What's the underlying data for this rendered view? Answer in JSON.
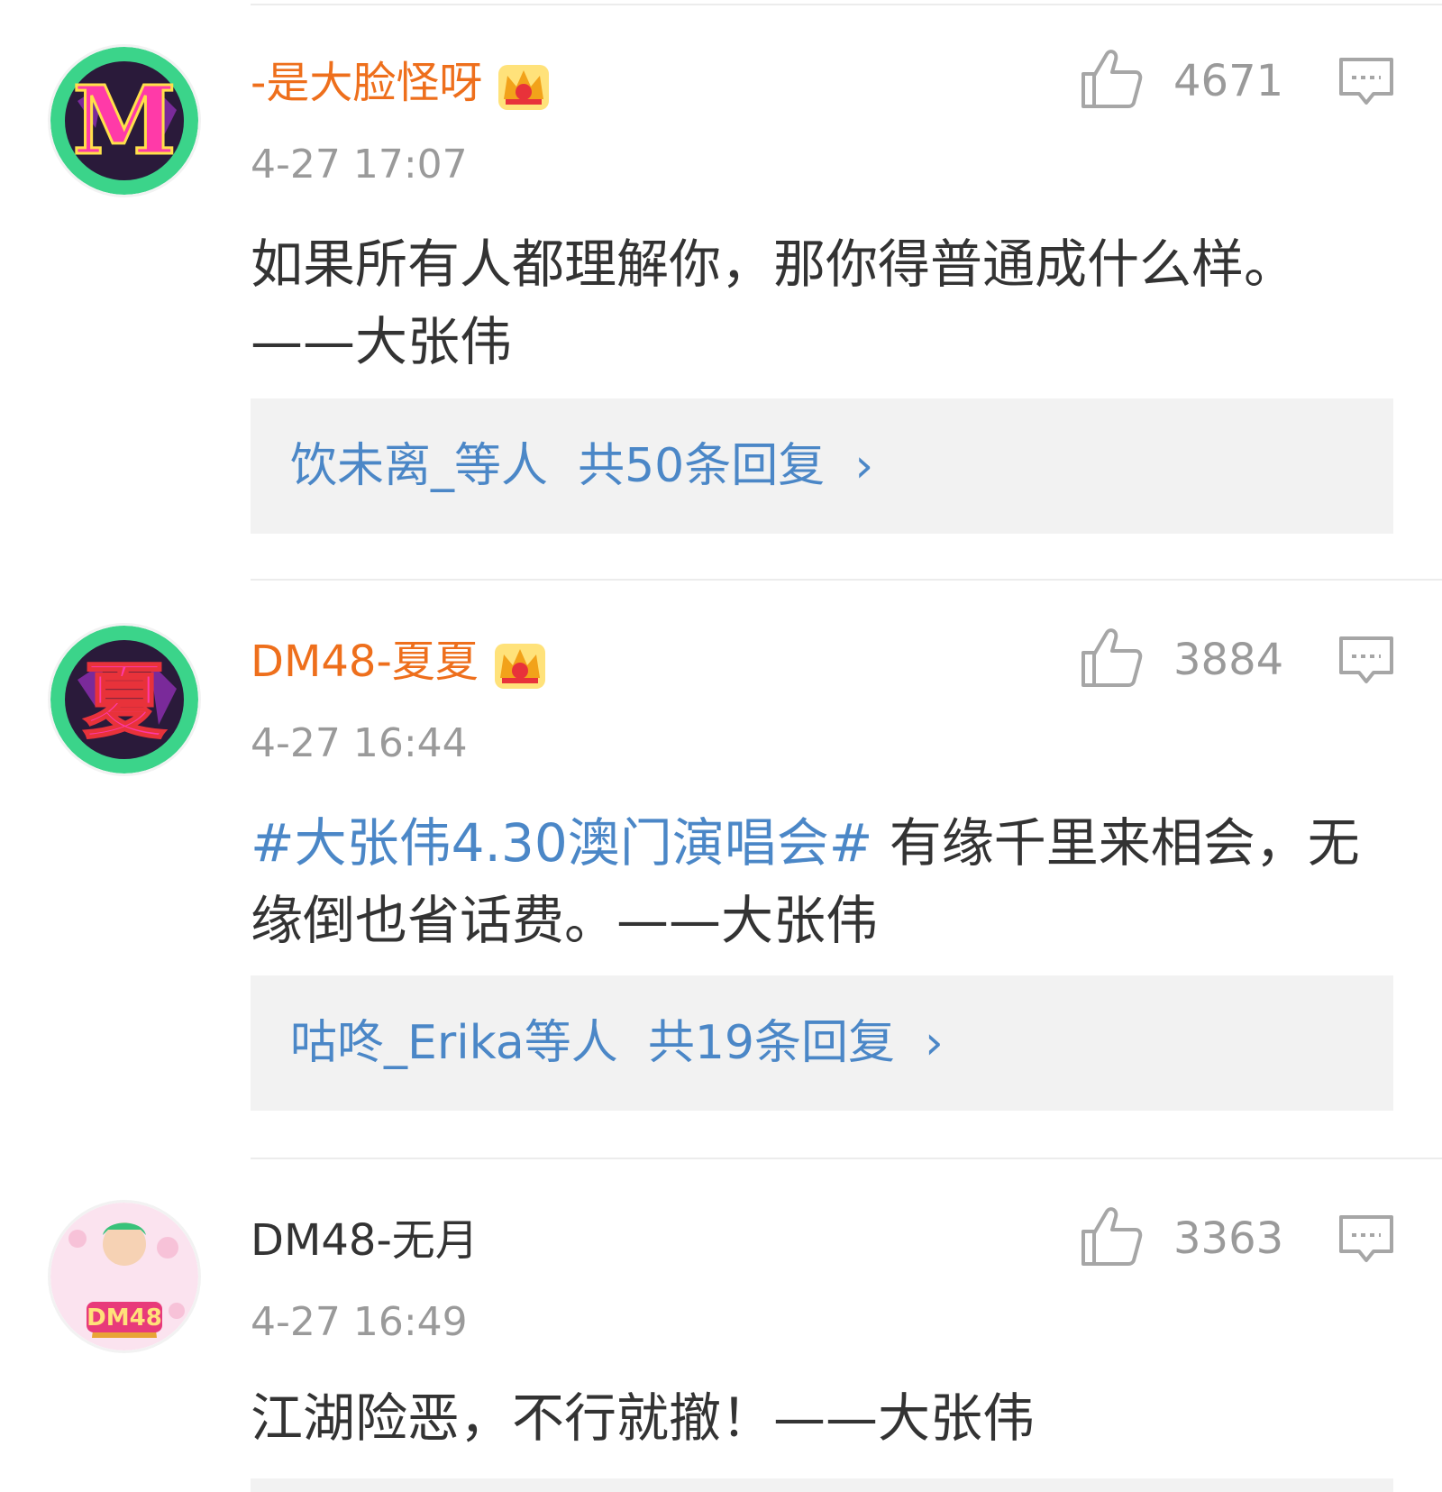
{
  "comments": [
    {
      "username": "-是大脸怪呀",
      "time": "4-27 17:07",
      "topic": "",
      "text": "如果所有人都理解你，那你得普通成什么样。——大张伟",
      "likes": "4671",
      "replies": {
        "users": "饮未离_等人",
        "count": "共50条回复",
        "chevron": "›"
      },
      "avatar_letter": "M"
    },
    {
      "username": "DM48-夏夏",
      "time": "4-27 16:44",
      "topic": "#大张伟4.30澳门演唱会#",
      "text": "有缘千里来相会，无缘倒也省话费。——大张伟",
      "likes": "3884",
      "replies": {
        "users": "咕咚_Erika等人",
        "count": "共19条回复",
        "chevron": "›"
      },
      "avatar_letter": "夏"
    },
    {
      "username": "DM48-无月",
      "time": "4-27 16:49",
      "topic": "",
      "text": "江湖险恶，不行就撤！——大张伟",
      "likes": "3363",
      "avatar_letter": "DM48"
    }
  ],
  "icons": {
    "like": "thumbs-up-icon",
    "comment": "comment-icon",
    "vip": "crown-icon"
  },
  "colors": {
    "vip_name": "#ee6f1c",
    "link": "#4b87c7",
    "meta": "#9a9a9a",
    "reply_bg": "#f2f2f2"
  }
}
